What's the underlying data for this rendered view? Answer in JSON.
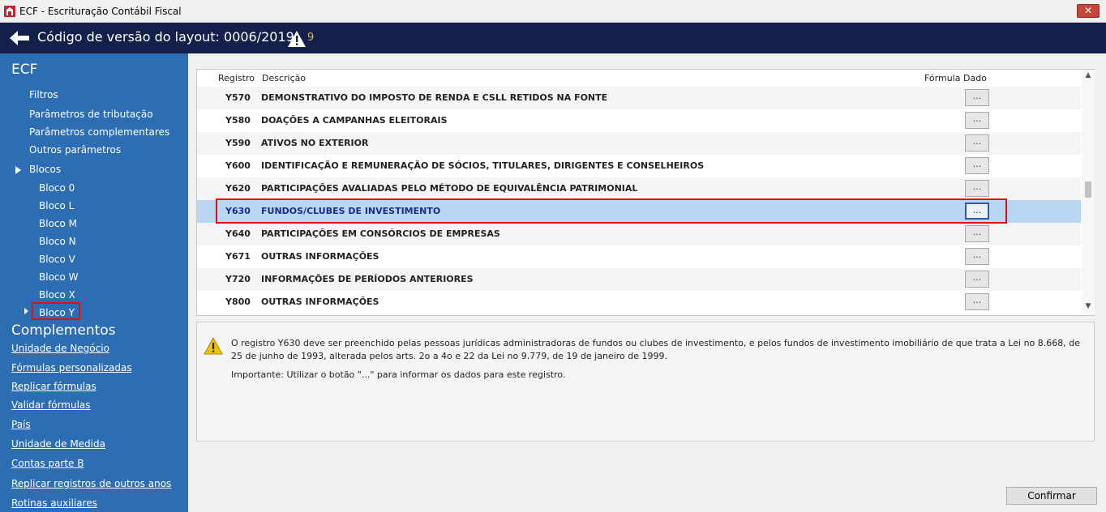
{
  "window": {
    "title": "ECF - Escrituração Contábil Fiscal",
    "close_label": "✕"
  },
  "header": {
    "title": "Código de versão do layout: 0006/2019",
    "warning_count": "9"
  },
  "sidebar": {
    "section1": "ECF",
    "items": [
      "Filtros",
      "Parâmetros de tributação",
      "Parâmetros complementares",
      "Outros parâmetros",
      "Blocos"
    ],
    "blocos": [
      "Bloco 0",
      "Bloco L",
      "Bloco M",
      "Bloco N",
      "Bloco V",
      "Bloco W",
      "Bloco X",
      "Bloco Y"
    ],
    "section2": "Complementos",
    "links": [
      "Unidade de Negócio",
      "Fórmulas personalizadas",
      "Replicar fórmulas",
      "Validar fórmulas",
      "País",
      "Unidade de Medida",
      "Contas parte B",
      "Replicar registros de outros anos",
      "Rotinas auxiliares"
    ]
  },
  "grid": {
    "columns": {
      "registro": "Registro",
      "descricao": "Descrição",
      "formula": "Fórmula",
      "dado": "Dado"
    },
    "button_label": "...",
    "rows": [
      {
        "code": "Y570",
        "desc": "DEMONSTRATIVO DO IMPOSTO DE RENDA E CSLL RETIDOS NA FONTE"
      },
      {
        "code": "Y580",
        "desc": "DOAÇÕES A CAMPANHAS ELEITORAIS"
      },
      {
        "code": "Y590",
        "desc": "ATIVOS NO EXTERIOR"
      },
      {
        "code": "Y600",
        "desc": "IDENTIFICAÇÃO E REMUNERAÇÃO DE SÓCIOS, TITULARES, DIRIGENTES E CONSELHEIROS"
      },
      {
        "code": "Y620",
        "desc": "PARTICIPAÇÕES AVALIADAS PELO MÉTODO DE EQUIVALÊNCIA PATRIMONIAL"
      },
      {
        "code": "Y630",
        "desc": "FUNDOS/CLUBES DE INVESTIMENTO"
      },
      {
        "code": "Y640",
        "desc": "PARTICIPAÇÕES EM CONSÓRCIOS DE EMPRESAS"
      },
      {
        "code": "Y671",
        "desc": "OUTRAS INFORMAÇÕES"
      },
      {
        "code": "Y720",
        "desc": "INFORMAÇÕES DE PERÍODOS ANTERIORES"
      },
      {
        "code": "Y800",
        "desc": "OUTRAS INFORMAÇÕES"
      }
    ]
  },
  "info": {
    "text": "O registro Y630 deve ser preenchido pelas pessoas jurídicas administradoras de fundos ou clubes de investimento, e pelos fundos de investimento imobiliário de que trata a Lei no 8.668, de 25 de junho de 1993, alterada pelos arts. 2o a 4o e 22 da Lei no 9.779, de 19 de janeiro de 1999.",
    "important": "Importante: Utilizar o botão \"...\" para informar os dados para este registro."
  },
  "confirm_label": "Confirmar",
  "colors": {
    "header_bg": "#12204a",
    "sidebar_bg": "#2d6db3",
    "selected_row": "#b9d7f5",
    "highlight_box": "#e01010"
  }
}
